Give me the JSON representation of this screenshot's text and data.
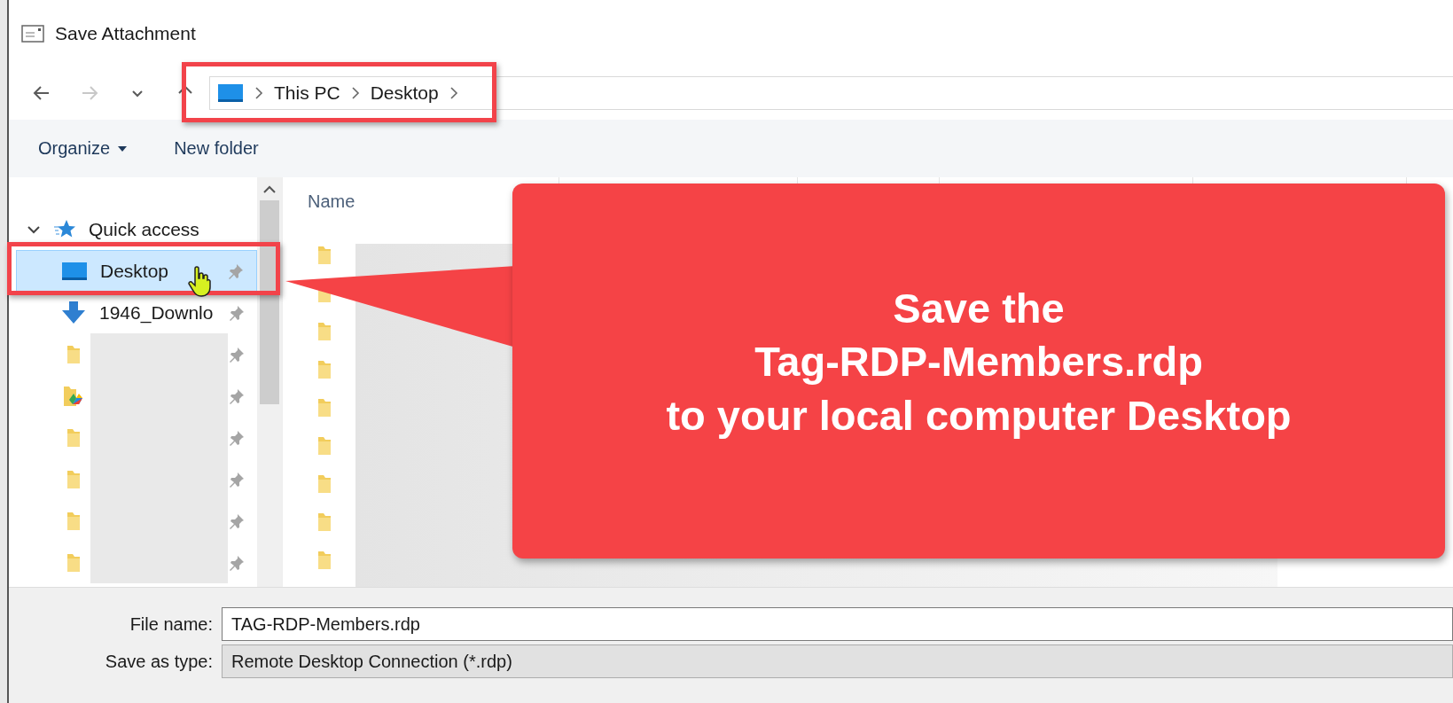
{
  "window": {
    "title": "Save Attachment"
  },
  "nav_buttons": [
    {
      "kind": "back",
      "disabled": false
    },
    {
      "kind": "forward",
      "disabled": true
    },
    {
      "kind": "recent",
      "disabled": false
    },
    {
      "kind": "up",
      "disabled": false
    }
  ],
  "address_bar": {
    "breadcrumb": [
      "This PC",
      "Desktop"
    ]
  },
  "toolbar": {
    "items": [
      {
        "label": "Organize",
        "kind": "menu"
      },
      {
        "label": "New folder",
        "kind": "button"
      }
    ]
  },
  "sidebar": {
    "items": [
      {
        "label": "Quick access",
        "kind": "star",
        "expanded": true,
        "selected": false,
        "children": [
          {
            "label": "Desktop",
            "kind": "desktop",
            "selected": true,
            "pinned": true
          },
          {
            "label": "1946_Downlo",
            "kind": "download",
            "selected": false,
            "pinned": true
          },
          {
            "kind": "folder",
            "selected": false,
            "pinned": true
          },
          {
            "kind": "drive-folder",
            "selected": false,
            "pinned": true
          },
          {
            "kind": "folder",
            "selected": false,
            "pinned": true
          },
          {
            "kind": "folder",
            "selected": false,
            "pinned": true
          },
          {
            "kind": "folder",
            "selected": false,
            "pinned": true
          },
          {
            "kind": "folder",
            "selected": false,
            "pinned": true
          }
        ]
      }
    ]
  },
  "file_list": {
    "columns": [
      "Name"
    ],
    "rows": [
      {
        "kind": "folder"
      },
      {
        "kind": "folder"
      },
      {
        "kind": "folder"
      },
      {
        "kind": "folder"
      },
      {
        "kind": "folder"
      },
      {
        "kind": "folder"
      },
      {
        "kind": "folder"
      },
      {
        "kind": "folder"
      },
      {
        "kind": "folder"
      }
    ]
  },
  "callout": {
    "lines": [
      "Save the",
      "Tag-RDP-Members.rdp",
      "to your local computer Desktop"
    ]
  },
  "save_form": {
    "fields": [
      {
        "label": "File name:",
        "value": "TAG-RDP-Members.rdp",
        "kind": "input"
      },
      {
        "label": "Save as type:",
        "value": "Remote Desktop Connection (*.rdp)",
        "kind": "select"
      }
    ]
  }
}
